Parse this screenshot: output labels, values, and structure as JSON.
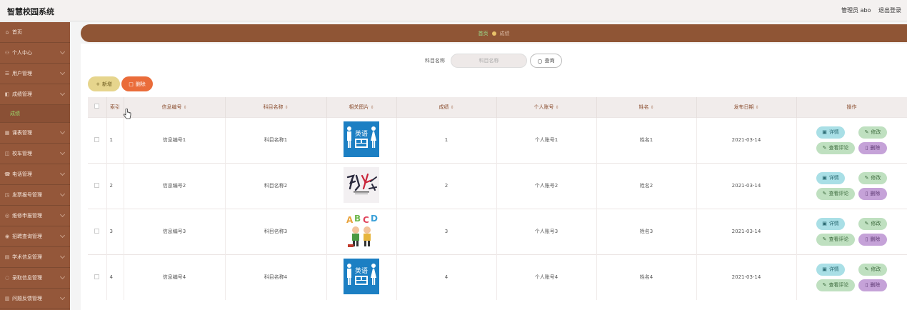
{
  "app": {
    "title": "智慧校园系统"
  },
  "topbar": {
    "user": "管理员 abo",
    "logout": "退出登录"
  },
  "sidebar": {
    "items": [
      {
        "label": "首页",
        "icon": "home-icon"
      },
      {
        "label": "个人中心",
        "icon": "user-icon"
      },
      {
        "label": "用户管理",
        "icon": "users-icon"
      },
      {
        "label": "成绩管理",
        "icon": "grade-icon"
      },
      {
        "label": "成绩",
        "icon": "",
        "sub": true
      },
      {
        "label": "课表管理",
        "icon": "table-icon"
      },
      {
        "label": "校车管理",
        "icon": "bus-icon"
      },
      {
        "label": "电话管理",
        "icon": "phone-icon"
      },
      {
        "label": "发票报号管理",
        "icon": "invoice-icon"
      },
      {
        "label": "维修申报管理",
        "icon": "repair-icon"
      },
      {
        "label": "招聘查询管理",
        "icon": "job-icon"
      },
      {
        "label": "学术信息管理",
        "icon": "doc-icon"
      },
      {
        "label": "录取信息管理",
        "icon": "admit-icon"
      },
      {
        "label": "问题反馈管理",
        "icon": "feedback-icon"
      }
    ]
  },
  "breadcrumb": {
    "home": "首页",
    "current": "成绩"
  },
  "search": {
    "label": "科目名称",
    "placeholder": "科目名称",
    "button": "查询"
  },
  "actions": {
    "add": "新增",
    "delete": "删除"
  },
  "table": {
    "headers": [
      "索引",
      "信息编号",
      "科目名称",
      "相关图片",
      "成绩",
      "个人账号",
      "姓名",
      "发布日期",
      "操作"
    ],
    "rows": [
      {
        "index": "1",
        "info_no": "信息编号1",
        "subject": "科目名称1",
        "image": "english-book",
        "score": "1",
        "account": "个人账号1",
        "name": "姓名1",
        "date": "2021-03-14"
      },
      {
        "index": "2",
        "info_no": "信息编号2",
        "subject": "科目名称2",
        "image": "health-art",
        "score": "2",
        "account": "个人账号2",
        "name": "姓名2",
        "date": "2021-03-14"
      },
      {
        "index": "3",
        "info_no": "信息编号3",
        "subject": "科目名称3",
        "image": "abcd-kids",
        "score": "3",
        "account": "个人账号3",
        "name": "姓名3",
        "date": "2021-03-14"
      },
      {
        "index": "4",
        "info_no": "信息编号4",
        "subject": "科目名称4",
        "image": "english-book",
        "score": "4",
        "account": "个人账号4",
        "name": "姓名4",
        "date": "2021-03-14"
      }
    ],
    "ops": {
      "detail": "详情",
      "edit": "修改",
      "comment": "查看评论",
      "remove": "删除"
    }
  },
  "image_text": {
    "english": "英语"
  },
  "colors": {
    "sidebar": "#94573a",
    "breadcrumb": "#8f5535",
    "accent_green": "#9bd46a",
    "delete": "#ea6c3a",
    "add": "#e6d58d"
  }
}
